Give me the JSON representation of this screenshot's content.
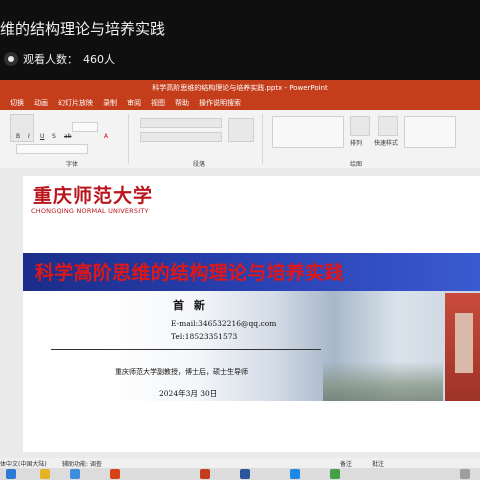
{
  "stream": {
    "title": "维的结构理论与培养实践",
    "viewer_label": "观看人数：",
    "viewer_count": "460人"
  },
  "ppt": {
    "window_title": "科学高阶思维的结构理论与培养实践.pptx - PowerPoint",
    "menu": [
      "切换",
      "动画",
      "幻灯片放映",
      "录制",
      "审阅",
      "视图",
      "帮助",
      "操作说明搜索"
    ],
    "ribbon": {
      "groups": [
        "字体",
        "段落",
        "绘图"
      ],
      "format_buttons": [
        "B",
        "I",
        "U",
        "S",
        "ab",
        "A"
      ],
      "arrange": "排列",
      "quick_styles": "快速样式"
    },
    "status": {
      "language": "体中文(中国大陆)",
      "accessibility": "辅助功能: 调查",
      "notes": "备注",
      "comments": "批注"
    }
  },
  "slide": {
    "logo_cn": "重庆师范大学",
    "logo_en": "CHONGQING NORMAL UNIVERSITY",
    "title": "科学高阶思维的结构理论与培养实践",
    "presenter": "首 新",
    "email": "E-mail:346532216@qq.com",
    "tel": "Tel:18523351573",
    "affiliation": "重庆师范大学副教授，博士后，硕士生导师",
    "date": "2024年3月 30日"
  },
  "colors": {
    "ppt_accent": "#c43e1c",
    "banner_blue": "#2a43b5",
    "title_red": "#e01717",
    "logo_red": "#b8151c"
  }
}
